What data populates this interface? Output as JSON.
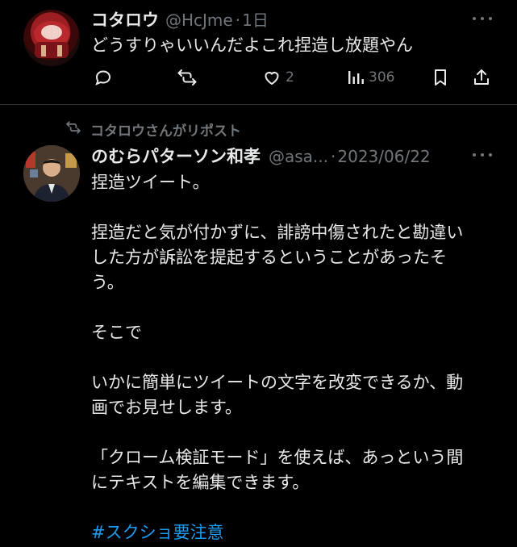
{
  "tweet1": {
    "display_name": "コタロウ",
    "handle": "@HcJme",
    "separator": "·",
    "time": "1日",
    "text": "どうすりゃいいんだよこれ捏造し放題やん",
    "likes": "2",
    "views": "306"
  },
  "tweet2": {
    "repost_label": "コタロウさんがリポスト",
    "display_name": "のむらパターソン和孝",
    "handle": "@asa...",
    "separator": "·",
    "date": "2023/06/22",
    "lines": [
      "捏造ツイート。",
      "",
      "捏造だと気が付かずに、誹謗中傷されたと勘違い",
      "した方が訴訟を提起するということがあったそ",
      "う。",
      "",
      "そこで",
      "",
      "いかに簡単にツイートの文字を改変できるか、動",
      "画でお見せします。",
      "",
      "「クローム検証モード」を使えば、あっという間",
      "にテキストを編集できます。",
      ""
    ],
    "hashtag": "#スクショ要注意"
  },
  "icons": [
    "reply-icon",
    "retweet-icon",
    "like-icon",
    "views-icon",
    "bookmark-icon",
    "share-icon",
    "more-icon",
    "repost-icon"
  ],
  "colors": {
    "background": "#000000",
    "text": "#e7e9ea",
    "muted": "#71767b",
    "link": "#1d9bf0",
    "divider": "#2f3336"
  }
}
